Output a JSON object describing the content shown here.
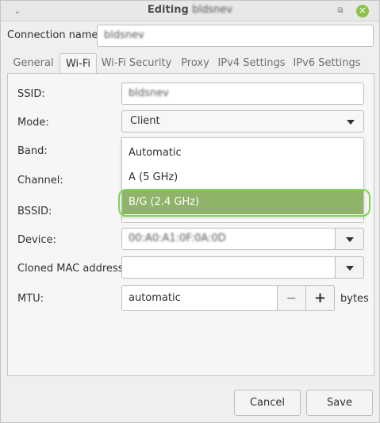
{
  "window": {
    "title_prefix": "Editing",
    "title_name": "bldsnev",
    "menu_icon": "chevron-down-icon",
    "restore_icon": "restore-icon",
    "close_icon": "close-icon",
    "accent": "#8bc34a"
  },
  "connection": {
    "label": "Connection name:",
    "value": "bldsnev"
  },
  "tabs": [
    {
      "label": "General"
    },
    {
      "label": "Wi-Fi"
    },
    {
      "label": "Wi-Fi Security"
    },
    {
      "label": "Proxy"
    },
    {
      "label": "IPv4 Settings"
    },
    {
      "label": "IPv6 Settings"
    }
  ],
  "wifi": {
    "ssid_label": "SSID:",
    "ssid_value": "bldsnev",
    "mode_label": "Mode:",
    "mode_value": "Client",
    "band_label": "Band:",
    "channel_label": "Channel:",
    "bssid_label": "BSSID:",
    "device_label": "Device:",
    "device_value": "00:A0:A1:0F:0A:0D",
    "cloned_mac_label": "Cloned MAC address:",
    "cloned_mac_value": "",
    "mtu_label": "MTU:",
    "mtu_value": "automatic",
    "mtu_minus": "−",
    "mtu_plus": "+",
    "mtu_unit": "bytes"
  },
  "band_dropdown": {
    "options": [
      "Automatic",
      "A (5 GHz)",
      "B/G (2.4 GHz)"
    ],
    "selected": "B/G (2.4 GHz)",
    "highlight_color": "#90b36a",
    "ring_color": "#7cd651"
  },
  "buttons": {
    "cancel": "Cancel",
    "save": "Save"
  }
}
